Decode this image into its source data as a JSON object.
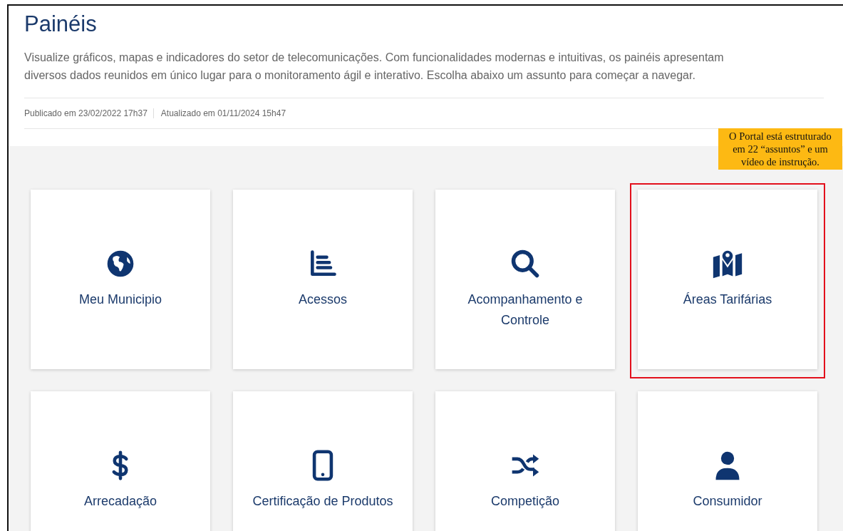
{
  "page": {
    "title": "Painéis",
    "description": "Visualize gráficos, mapas e indicadores do setor de telecomunicações. Com funcionalidades modernas e intuitivas, os painéis apresentam diversos dados reunidos em único lugar para o monitoramento ágil e interativo. Escolha abaixo um assunto para começar a navegar.",
    "published": "Publicado em 23/02/2022 17h37",
    "updated": "Atualizado em 01/11/2024 15h47"
  },
  "cards": [
    {
      "label": "Meu Municipio",
      "highlighted": false
    },
    {
      "label": "Acessos",
      "highlighted": false
    },
    {
      "label": "Acompanhamento e Controle",
      "highlighted": false
    },
    {
      "label": "Áreas Tarifárias",
      "highlighted": true
    },
    {
      "label": "Arrecadação",
      "highlighted": false
    },
    {
      "label": "Certificação de Produtos",
      "highlighted": false
    },
    {
      "label": "Competição",
      "highlighted": false
    },
    {
      "label": "Consumidor",
      "highlighted": false
    }
  ],
  "callout": {
    "text": "O Portal está estruturado em 22 “assuntos” e um vídeo de instrução."
  }
}
